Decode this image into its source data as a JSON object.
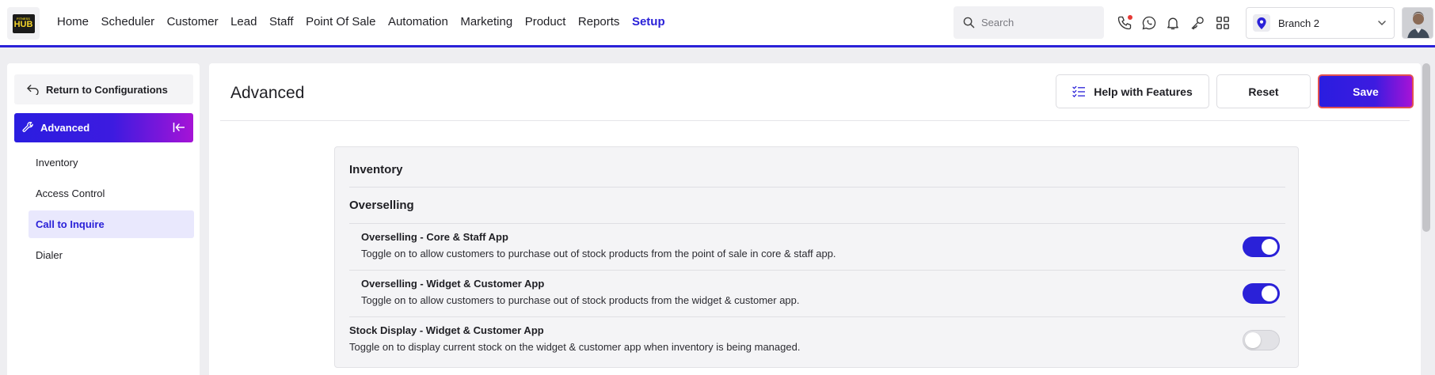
{
  "logo": {
    "line1": "FITNESS",
    "line2": "HUB"
  },
  "nav": {
    "items": [
      {
        "label": "Home"
      },
      {
        "label": "Scheduler"
      },
      {
        "label": "Customer"
      },
      {
        "label": "Lead"
      },
      {
        "label": "Staff"
      },
      {
        "label": "Point Of Sale"
      },
      {
        "label": "Automation"
      },
      {
        "label": "Marketing"
      },
      {
        "label": "Product"
      },
      {
        "label": "Reports"
      },
      {
        "label": "Setup",
        "active": true
      }
    ]
  },
  "search": {
    "placeholder": "Search"
  },
  "header_icons": [
    "phone-icon",
    "whatsapp-icon",
    "bell-icon",
    "key-icon",
    "apps-grid-icon"
  ],
  "branch": {
    "label": "Branch 2"
  },
  "colors": {
    "accent": "#2a21d8",
    "gradient_end": "#a613d6",
    "save_border": "#e25151",
    "notification": "#e53935"
  },
  "sidebar": {
    "return_label": "Return to Configurations",
    "section_label": "Advanced",
    "items": [
      {
        "label": "Inventory"
      },
      {
        "label": "Access Control"
      },
      {
        "label": "Call to Inquire",
        "active": true
      },
      {
        "label": "Dialer"
      }
    ]
  },
  "main": {
    "title": "Advanced",
    "help_label": "Help with Features",
    "reset_label": "Reset",
    "save_label": "Save",
    "card": {
      "heading": "Inventory",
      "subheading": "Overselling",
      "rows": [
        {
          "title": "Overselling - Core & Staff App",
          "desc": "Toggle on to allow customers to purchase out of stock products from the point of sale in core & staff app.",
          "enabled": true
        },
        {
          "title": "Overselling - Widget & Customer App",
          "desc": "Toggle on to allow customers to purchase out of stock products from the widget & customer app.",
          "enabled": true
        },
        {
          "title": "Stock Display - Widget & Customer App",
          "desc": "Toggle on to display current stock on the widget & customer app when inventory is being managed.",
          "enabled": false
        }
      ]
    }
  }
}
